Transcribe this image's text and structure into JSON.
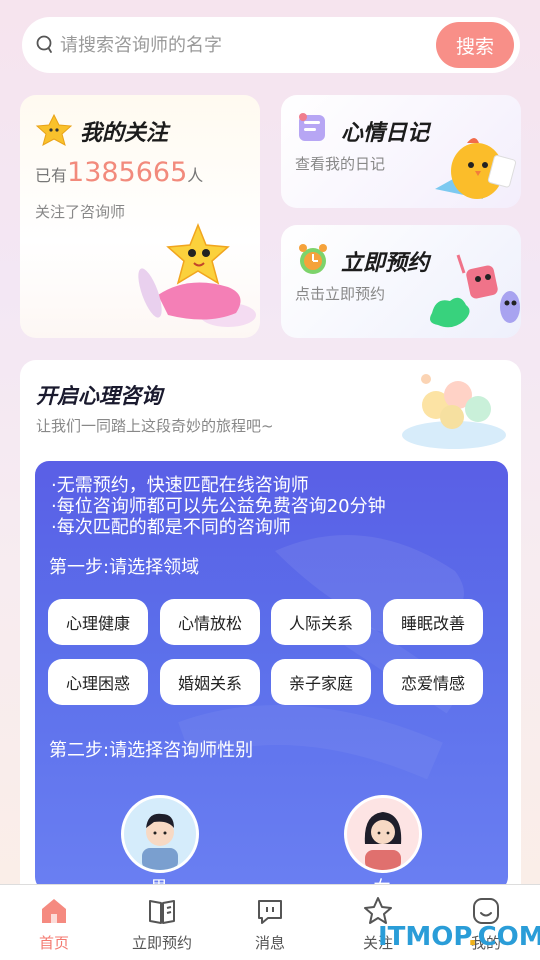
{
  "search": {
    "placeholder": "请搜索咨询师的名字",
    "button": "搜索"
  },
  "follow": {
    "title": "我的关注",
    "prefix": "已有",
    "count": "1385665",
    "suffix": "人",
    "sub": "关注了咨询师"
  },
  "diary": {
    "title": "心情日记",
    "sub": "查看我的日记"
  },
  "booking": {
    "title": "立即预约",
    "sub": "点击立即预约"
  },
  "consult": {
    "title": "开启心理咨询",
    "sub": "让我们一同踏上这段奇妙的旅程吧~",
    "bullets": [
      "·无需预约，快速匹配在线咨询师",
      "·每位咨询师都可以先公益免费咨询20分钟",
      "·每次匹配的都是不同的咨询师"
    ],
    "step1": "第一步:请选择领域",
    "fields": [
      "心理健康",
      "心情放松",
      "人际关系",
      "睡眠改善",
      "心理困惑",
      "婚姻关系",
      "亲子家庭",
      "恋爱情感"
    ],
    "step2": "第二步:请选择咨询师性别",
    "male": "男",
    "female": "女"
  },
  "tabs": [
    {
      "label": "首页",
      "icon": "home-icon",
      "active": true
    },
    {
      "label": "立即预约",
      "icon": "book-icon",
      "active": false
    },
    {
      "label": "消息",
      "icon": "message-icon",
      "active": false
    },
    {
      "label": "关注",
      "icon": "star-icon",
      "active": false
    },
    {
      "label": "我的",
      "icon": "profile-icon",
      "active": false
    }
  ],
  "watermark": {
    "text": "ITMOP",
    "dot": ".",
    "tld": "COM"
  },
  "colors": {
    "accent": "#f88f88",
    "blue_panel": "#5a5fe6",
    "count": "#f28a7c"
  }
}
